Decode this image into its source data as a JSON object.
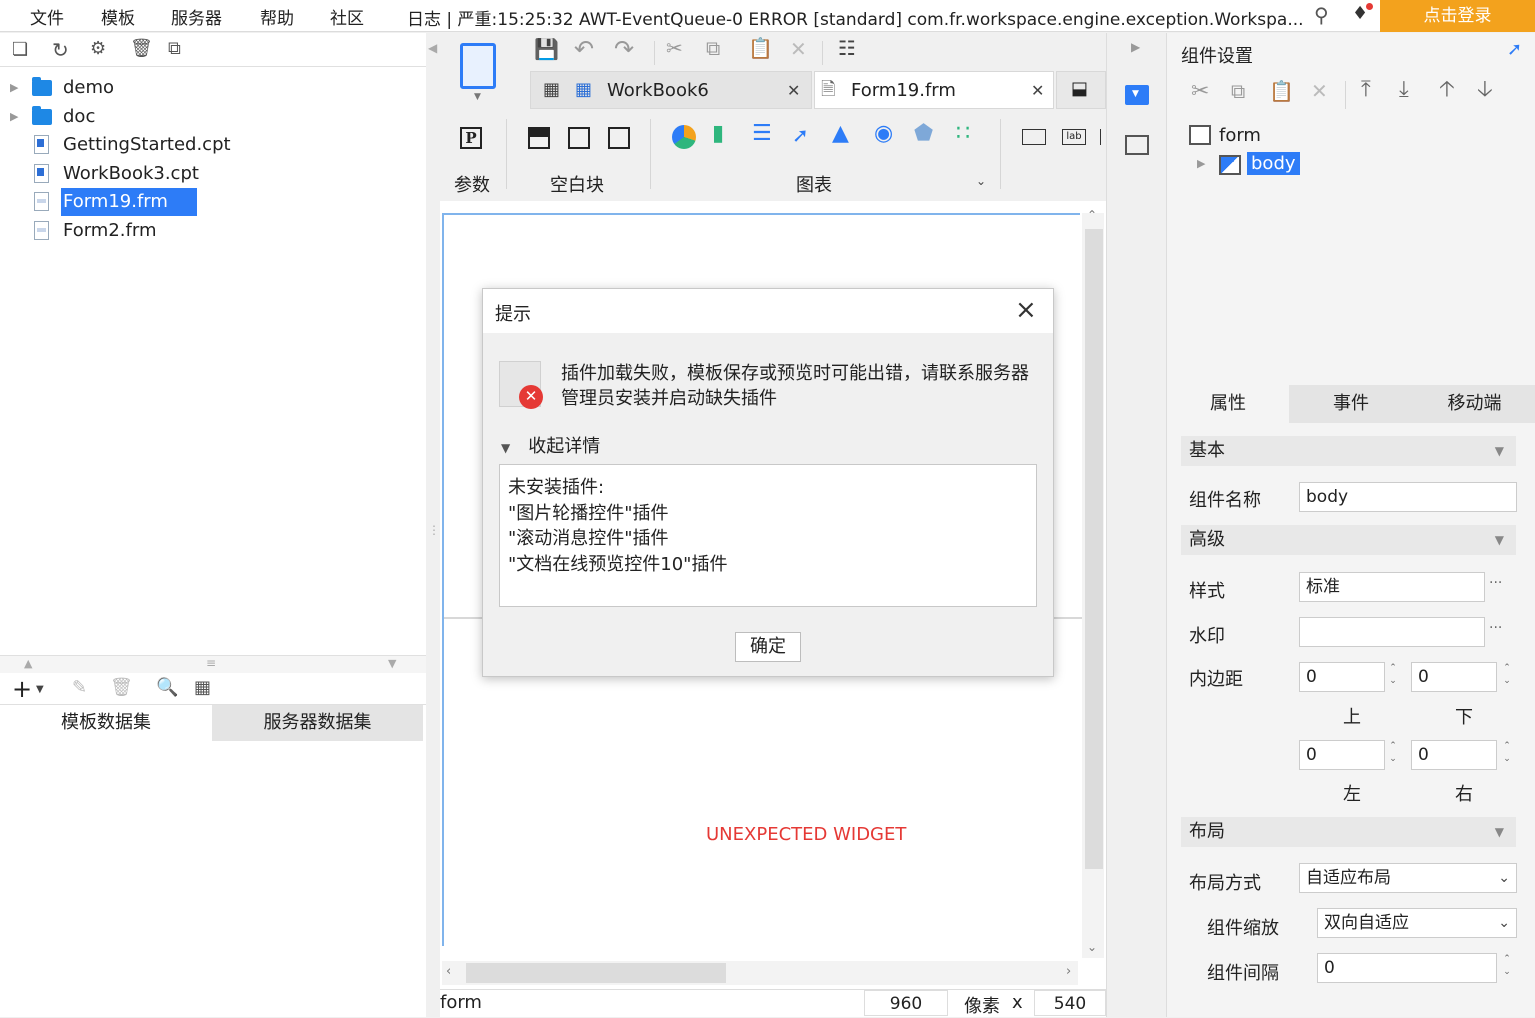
{
  "menubar": {
    "items": [
      "文件",
      "模板",
      "服务器",
      "帮助",
      "社区"
    ],
    "log": "日志 | 严重:15:25:32 AWT-EventQueue-0 ERROR [standard] com.fr.workspace.engine.exception.Workspa...",
    "login": "点击登录"
  },
  "tree": {
    "items": [
      {
        "label": "demo",
        "type": "folder"
      },
      {
        "label": "doc",
        "type": "folder"
      },
      {
        "label": "GettingStarted.cpt",
        "type": "cpt"
      },
      {
        "label": "WorkBook3.cpt",
        "type": "cpt"
      },
      {
        "label": "Form19.frm",
        "type": "frm"
      },
      {
        "label": "Form2.frm",
        "type": "frm"
      }
    ]
  },
  "datasets": {
    "tabs": [
      "模板数据集",
      "服务器数据集"
    ]
  },
  "editor": {
    "tabs": [
      "WorkBook6",
      "Form19.frm"
    ],
    "groups": [
      "参数",
      "空白块",
      "图表"
    ],
    "param_icon": "P",
    "label_icon": "lab"
  },
  "canvas": {
    "unexpected": "UNEXPECTED WIDGET"
  },
  "status": {
    "name": "form",
    "width": "960",
    "unit": "像素",
    "x": "x",
    "height": "540"
  },
  "right": {
    "title": "组件设置",
    "tree": {
      "root": "form",
      "child": "body"
    },
    "tabs": [
      "属性",
      "事件",
      "移动端"
    ],
    "basic": {
      "section": "基本",
      "name_label": "组件名称",
      "name_value": "body"
    },
    "advanced": {
      "section": "高级",
      "style_label": "样式",
      "style_value": "标准",
      "watermark_label": "水印",
      "watermark_value": "",
      "padding_label": "内边距",
      "top": "0",
      "bottom": "0",
      "left": "0",
      "right": "0",
      "top_label": "上",
      "bottom_label": "下",
      "left_label": "左",
      "right_label": "右"
    },
    "layout": {
      "section": "布局",
      "mode_label": "布局方式",
      "mode_value": "自适应布局",
      "scale_label": "组件缩放",
      "scale_value": "双向自适应",
      "gap_label": "组件间隔",
      "gap_value": "0"
    },
    "more": "···"
  },
  "dialog": {
    "title": "提示",
    "message": "插件加载失败，模板保存或预览时可能出错，请联系服务器管理员安装并启动缺失插件",
    "toggle": "收起详情",
    "details": [
      "未安装插件:",
      "\"图片轮播控件\"插件",
      "\"滚动消息控件\"插件",
      "\"文档在线预览控件10\"插件"
    ],
    "ok": "确定"
  },
  "colors": {
    "accent": "#2d7cf7",
    "login": "#f3a21d",
    "error": "#e53935"
  }
}
